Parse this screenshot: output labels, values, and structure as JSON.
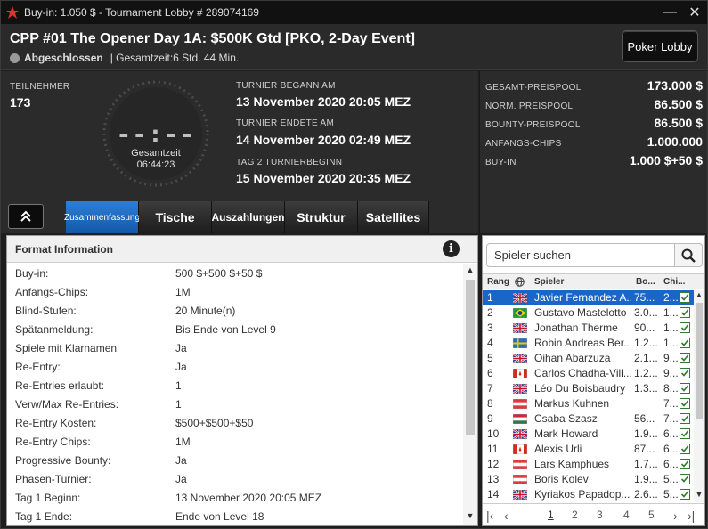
{
  "window": {
    "title": "Buy-in: 1.050 $ - Tournament Lobby # 289074169",
    "minimize": "—",
    "close": "✕"
  },
  "header": {
    "tournament_name": "CPP #01 The Opener Day 1A: $500K Gtd [PKO, 2-Day Event]",
    "status": "Abgeschlossen",
    "total_time": "| Gesamtzeit:6 Std.  44 Min.",
    "lobby_button": "Poker Lobby"
  },
  "info": {
    "participants_label": "TEILNEHMER",
    "participants_value": "173",
    "clock_display": "--:--",
    "clock_label": "Gesamtzeit",
    "clock_value": "06:44:23",
    "started_label": "TURNIER BEGANN AM",
    "started_value": "13 November 2020  20:05 MEZ",
    "ended_label": "TURNIER ENDETE AM",
    "ended_value": "14 November 2020  02:49 MEZ",
    "day2_label": "TAG 2 TURNIERBEGINN",
    "day2_value": "15 November 2020  20:35 MEZ"
  },
  "prizes": [
    {
      "label": "GESAMT-PREISPOOL",
      "value": "173.000 $"
    },
    {
      "label": "NORM. PREISPOOL",
      "value": "86.500 $"
    },
    {
      "label": "BOUNTY-PREISPOOL",
      "value": "86.500 $"
    },
    {
      "label": "ANFANGS-CHIPS",
      "value": "1.000.000"
    },
    {
      "label": "BUY-IN",
      "value": "1.000 $+50 $"
    }
  ],
  "tabs": [
    "Zusammenfassung",
    "Tische",
    "Auszahlungen",
    "Struktur",
    "Satellites"
  ],
  "format": {
    "title": "Format Information",
    "rows": [
      {
        "k": "Buy-in:",
        "v": "500 $+500 $+50 $"
      },
      {
        "k": "Anfangs-Chips:",
        "v": "1M"
      },
      {
        "k": "Blind-Stufen:",
        "v": "20 Minute(n)"
      },
      {
        "k": "Spätanmeldung:",
        "v": "Bis Ende von Level 9"
      },
      {
        "k": "Spiele mit Klarnamen",
        "v": "Ja"
      },
      {
        "k": "Re-Entry:",
        "v": "Ja"
      },
      {
        "k": "Re-Entries erlaubt:",
        "v": "1"
      },
      {
        "k": "Verw/Max Re-Entries:",
        "v": "1"
      },
      {
        "k": "Re-Entry Kosten:",
        "v": "$500+$500+$50"
      },
      {
        "k": "Re-Entry Chips:",
        "v": "1M"
      },
      {
        "k": "Progressive Bounty:",
        "v": "Ja"
      },
      {
        "k": "Phasen-Turnier:",
        "v": "Ja"
      },
      {
        "k": "Tag 1 Beginn:",
        "v": "13 November 2020  20:05 MEZ"
      },
      {
        "k": "Tag 1 Ende:",
        "v": "Ende von Level 18"
      }
    ]
  },
  "players": {
    "search_placeholder": "Spieler suchen",
    "col_rank": "Rang",
    "col_player": "Spieler",
    "col_bounty": "Bo...",
    "col_chips": "Chi...",
    "rows": [
      {
        "rank": "1",
        "flag": "gb",
        "name": "Javier Fernandez A...",
        "bo": "75...",
        "chi": "2..."
      },
      {
        "rank": "2",
        "flag": "br",
        "name": "Gustavo Mastelotto",
        "bo": "3.0...",
        "chi": "1..."
      },
      {
        "rank": "3",
        "flag": "gb",
        "name": "Jonathan Therme",
        "bo": "90...",
        "chi": "1..."
      },
      {
        "rank": "4",
        "flag": "se",
        "name": "Robin Andreas Ber...",
        "bo": "1.2...",
        "chi": "1..."
      },
      {
        "rank": "5",
        "flag": "gb",
        "name": "Oihan Abarzuza",
        "bo": "2.1...",
        "chi": "9..."
      },
      {
        "rank": "6",
        "flag": "ca",
        "name": "Carlos Chadha-Vill...",
        "bo": "1.2...",
        "chi": "9..."
      },
      {
        "rank": "7",
        "flag": "gb",
        "name": "Léo Du Boisbaudry",
        "bo": "1.3...",
        "chi": "8..."
      },
      {
        "rank": "8",
        "flag": "at",
        "name": "Markus Kuhnen",
        "bo": "",
        "chi": "7..."
      },
      {
        "rank": "9",
        "flag": "hu",
        "name": "Csaba Szasz",
        "bo": "56...",
        "chi": "7..."
      },
      {
        "rank": "10",
        "flag": "gb",
        "name": "Mark Howard",
        "bo": "1.9...",
        "chi": "6..."
      },
      {
        "rank": "11",
        "flag": "ca",
        "name": "Alexis Urli",
        "bo": "87...",
        "chi": "6..."
      },
      {
        "rank": "12",
        "flag": "at",
        "name": "Lars Kamphues",
        "bo": "1.7...",
        "chi": "6..."
      },
      {
        "rank": "13",
        "flag": "at",
        "name": "Boris Kolev",
        "bo": "1.9...",
        "chi": "5..."
      },
      {
        "rank": "14",
        "flag": "gb",
        "name": "Kyriakos Papadop...",
        "bo": "2.6...",
        "chi": "5..."
      }
    ],
    "pages": [
      "1",
      "2",
      "3",
      "4",
      "5"
    ]
  },
  "colors": {
    "accent": "#1a66c8",
    "tab_active": "#2d7fd6",
    "brand": "#e0312b"
  }
}
